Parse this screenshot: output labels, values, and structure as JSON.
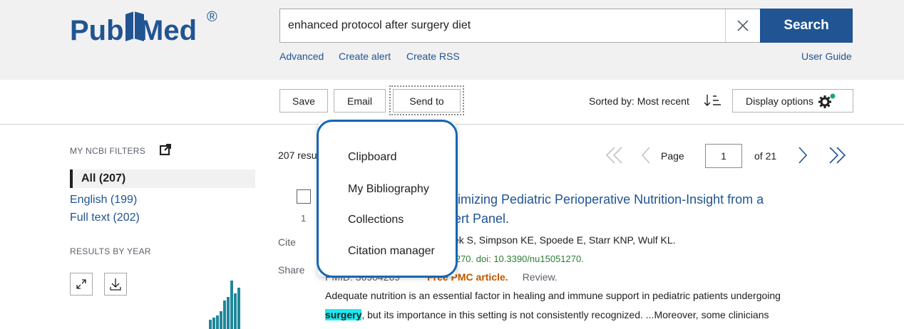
{
  "brand": {
    "logo_left": "Pub",
    "logo_right": "Med",
    "logo_mark": "®"
  },
  "search": {
    "query": "enhanced protocol after surgery diet",
    "button_label": "Search"
  },
  "search_links": {
    "advanced": "Advanced",
    "create_alert": "Create alert",
    "create_rss": "Create RSS",
    "user_guide": "User Guide"
  },
  "toolbar": {
    "save": "Save",
    "email": "Email",
    "send_to": "Send to",
    "sorted_by": "Sorted by: Most recent",
    "display_options": "Display options"
  },
  "sidebar": {
    "my_ncbi_filters": "MY NCBI FILTERS",
    "filters": [
      {
        "label": "All (207)",
        "active": true
      },
      {
        "label": "English (199)",
        "active": false
      },
      {
        "label": "Full text (202)",
        "active": false
      }
    ],
    "results_by_year": "RESULTS BY YEAR",
    "year_bars": [
      0.18,
      0.22,
      0.26,
      0.35,
      0.55,
      0.62,
      0.95,
      0.7,
      0.8
    ]
  },
  "results": {
    "count_text": "207 resu",
    "page_label": "Page",
    "page_value": "1",
    "of_pages": "of 21"
  },
  "result1": {
    "number": "1",
    "cite": "Cite",
    "share": "Share",
    "title_line1": "timizing Pediatric Perioperative Nutrition-Insight from a",
    "title_line2": "ert Panel.",
    "authors": "ček S, Simpson KE, Spoede E, Starr KNP, Wulf KL.",
    "citation": ":1270. doi: 10.3390/nu15051270.",
    "pmid": "PMID: 36904269",
    "free_pmc": "Free PMC article.",
    "review": "Review.",
    "abstract_line1": "Adequate nutrition is an essential factor in healing and immune support in pediatric patients undergoing",
    "abstract_highlight": "surgery",
    "abstract_line2_rest": ", but its importance in this setting is not consistently recognized. ...Moreover, some clinicians"
  },
  "send_to_menu": {
    "items": [
      "Clipboard",
      "My Bibliography",
      "Collections",
      "Citation manager"
    ]
  },
  "colors": {
    "brand_blue": "#205493",
    "bar_teal": "#20889a",
    "highlight": "#1ee8ef",
    "focus_ring": "#1566b3",
    "free_pmc": "#c05600"
  }
}
